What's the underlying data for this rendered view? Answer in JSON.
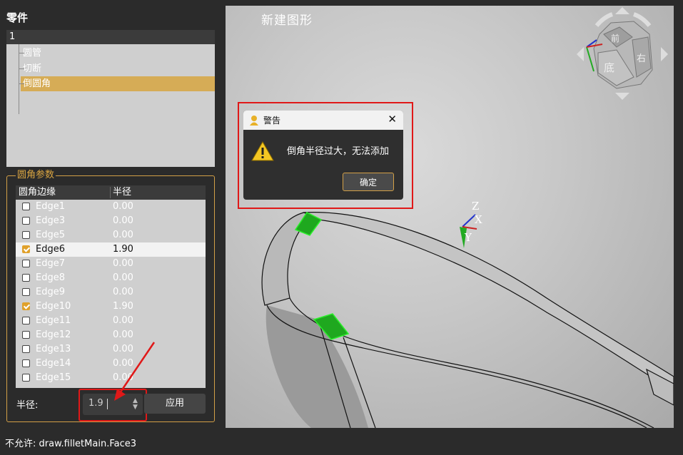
{
  "left_panel": {
    "title": "零件",
    "tree": {
      "root": "1",
      "items": [
        {
          "label": "圆管",
          "selected": false
        },
        {
          "label": "切断",
          "selected": false
        },
        {
          "label": "倒圆角",
          "selected": true
        }
      ]
    },
    "fillet_group": {
      "title": "圆角参数",
      "columns": [
        "圆角边缘",
        "半径"
      ],
      "rows": [
        {
          "edge": "Edge1",
          "radius": "0.00",
          "checked": false
        },
        {
          "edge": "Edge3",
          "radius": "0.00",
          "checked": false
        },
        {
          "edge": "Edge5",
          "radius": "0.00",
          "checked": false
        },
        {
          "edge": "Edge6",
          "radius": "1.90",
          "checked": true
        },
        {
          "edge": "Edge7",
          "radius": "0.00",
          "checked": false
        },
        {
          "edge": "Edge8",
          "radius": "0.00",
          "checked": false
        },
        {
          "edge": "Edge9",
          "radius": "0.00",
          "checked": false
        },
        {
          "edge": "Edge10",
          "radius": "1.90",
          "checked": true
        },
        {
          "edge": "Edge11",
          "radius": "0.00",
          "checked": false
        },
        {
          "edge": "Edge12",
          "radius": "0.00",
          "checked": false
        },
        {
          "edge": "Edge13",
          "radius": "0.00",
          "checked": false
        },
        {
          "edge": "Edge14",
          "radius": "0.00",
          "checked": false
        },
        {
          "edge": "Edge15",
          "radius": "0.00",
          "checked": false
        }
      ],
      "radius_label": "半径:",
      "radius_value": "1.9",
      "apply_label": "应用"
    }
  },
  "viewport": {
    "title": "新建图形",
    "view_cube": {
      "labels": [
        "前",
        "右",
        "底"
      ]
    },
    "axes": {
      "z": "Z",
      "x": "X",
      "y": "Y"
    }
  },
  "dialog": {
    "title": "警告",
    "message": "倒角半径过大，无法添加",
    "ok_label": "确定",
    "close_symbol": "✕"
  },
  "status_bar": {
    "text": "不允许:   draw.filletMain.Face3"
  },
  "colors": {
    "accent": "#d6ac56",
    "highlight_red": "#e01818",
    "edge_green": "#22c322"
  }
}
